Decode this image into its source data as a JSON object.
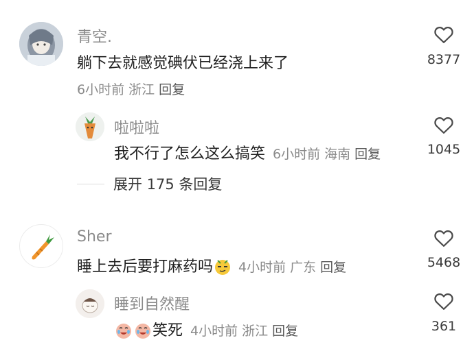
{
  "comments": [
    {
      "username": "青空.",
      "text": "躺下去就感觉碘伏已经浇上来了",
      "meta": "6小时前 浙江",
      "reply_label": "回复",
      "likes": "8377",
      "replies": [
        {
          "username": "啦啦啦",
          "text": "我不行了怎么这么搞笑",
          "meta": "6小时前 海南",
          "reply_label": "回复",
          "likes": "1045"
        }
      ],
      "expand_label": "展开 175 条回复"
    },
    {
      "username": "Sher",
      "text": "睡上去后要打麻药吗",
      "meta": "4小时前 广东",
      "reply_label": "回复",
      "likes": "5468",
      "replies": [
        {
          "username": "睡到自然醒",
          "text": "笑死",
          "meta": "4小时前 浙江",
          "reply_label": "回复",
          "likes": "361"
        }
      ]
    }
  ],
  "icons": {
    "like": "heart-outline-icon",
    "emoji_face": "smirk-emoji-icon",
    "emoji_cry": "laugh-cry-emoji-icon"
  }
}
